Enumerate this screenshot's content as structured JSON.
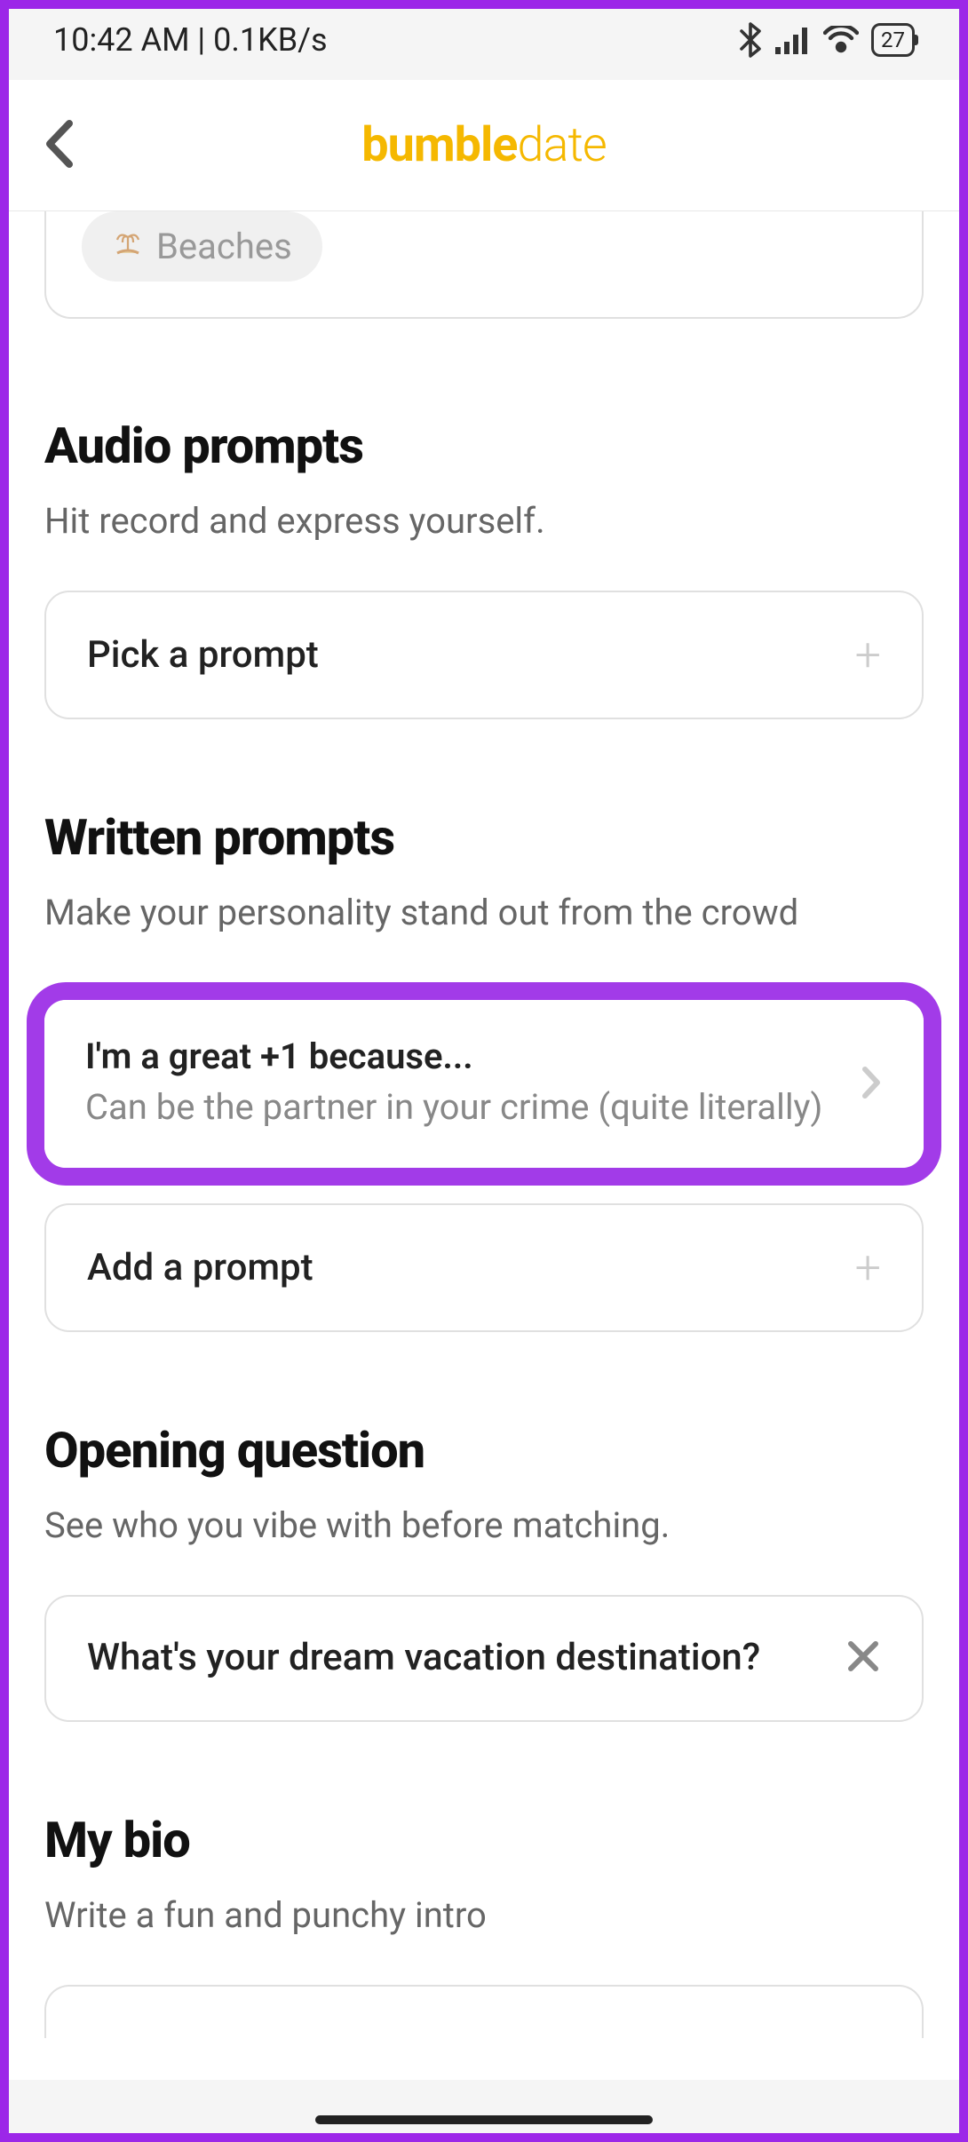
{
  "status_bar": {
    "time": "10:42 AM",
    "data_rate": "0.1KB/s",
    "battery": "27"
  },
  "header": {
    "logo_bold": "bumble",
    "logo_light": "date"
  },
  "interests": {
    "chip_label": "Beaches"
  },
  "audio_prompts": {
    "title": "Audio prompts",
    "subtitle": "Hit record and express yourself.",
    "pick_label": "Pick a prompt"
  },
  "written_prompts": {
    "title": "Written prompts",
    "subtitle": "Make your personality stand out from the crowd",
    "prompt1_title": "I'm a great +1 because...",
    "prompt1_answer": "Can be the partner in your crime (quite literally)",
    "add_label": "Add a prompt"
  },
  "opening_question": {
    "title": "Opening question",
    "subtitle": "See who you vibe with before matching.",
    "question": "What's your dream vacation destination?"
  },
  "my_bio": {
    "title": "My bio",
    "subtitle": "Write a fun and punchy intro"
  }
}
